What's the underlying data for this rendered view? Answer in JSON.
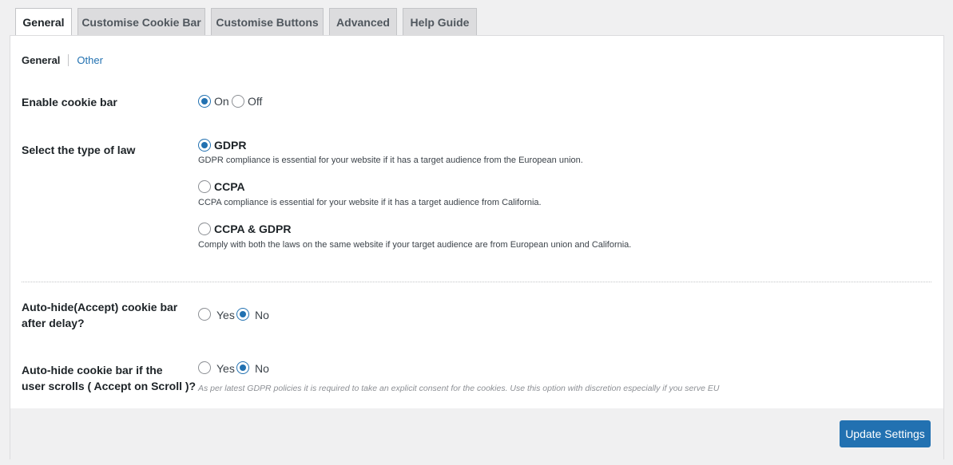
{
  "tabs": [
    "General",
    "Customise Cookie Bar",
    "Customise Buttons",
    "Advanced",
    "Help Guide"
  ],
  "subtabs": {
    "active": "General",
    "other": "Other"
  },
  "enable_cookie_bar": {
    "label": "Enable cookie bar",
    "options": [
      "On",
      "Off"
    ],
    "selected": "On"
  },
  "law_type": {
    "label": "Select the type of law",
    "selected": "GDPR",
    "options": [
      {
        "name": "GDPR",
        "description": "GDPR compliance is essential for your website if it has a target audience from the European union."
      },
      {
        "name": "CCPA",
        "description": "CCPA compliance is essential for your website if it has a target audience from California."
      },
      {
        "name": "CCPA & GDPR",
        "description": "Comply with both the laws on the same website if your target audience are from European union and California."
      }
    ]
  },
  "auto_hide_delay": {
    "label_line1": "Auto-hide(Accept) cookie bar",
    "label_line2": "after delay?",
    "options": [
      "Yes",
      "No"
    ],
    "selected": "No"
  },
  "auto_hide_scroll": {
    "label_line1": "Auto-hide cookie bar if the",
    "label_line2": "user scrolls ( Accept on Scroll )?",
    "options": [
      "Yes",
      "No"
    ],
    "selected": "No",
    "note": "As per latest GDPR policies it is required to take an explicit consent for the cookies. Use this option with discretion especially if you serve EU"
  },
  "update_button": "Update Settings",
  "colors": {
    "accent": "#2271b1",
    "tab_inactive": "#dcdcde",
    "background": "#f0f0f1"
  }
}
